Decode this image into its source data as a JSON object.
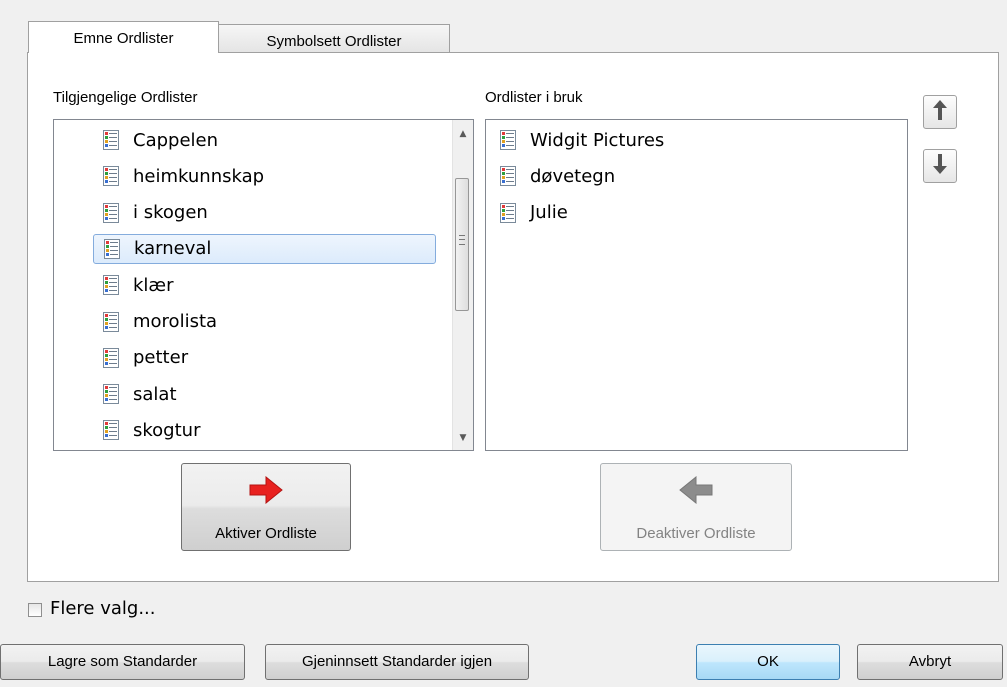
{
  "tabs": [
    {
      "label": "Emne Ordlister",
      "active": true
    },
    {
      "label": "Symbolsett Ordlister",
      "active": false
    }
  ],
  "available": {
    "label": "Tilgjengelige Ordlister",
    "items": [
      "Cappelen",
      "heimkunnskap",
      "i skogen",
      "karneval",
      "klær",
      "morolista",
      "petter",
      "salat",
      "skogtur"
    ],
    "selected_index": 3
  },
  "in_use": {
    "label": "Ordlister i bruk",
    "items": [
      "Widgit Pictures",
      "døvetegn",
      "Julie"
    ]
  },
  "buttons": {
    "activate": "Aktiver Ordliste",
    "deactivate": "Deaktiver Ordliste",
    "save_default": "Lagre som Standarder",
    "restore_default": "Gjeninnsett Standarder igjen",
    "ok": "OK",
    "cancel": "Avbryt"
  },
  "more_options": {
    "label": "Flere valg...",
    "checked": false
  },
  "icons": {
    "list": "list-icon",
    "move_up": "arrow-up-icon",
    "move_down": "arrow-down-icon",
    "activate": "red-arrow-right-icon",
    "deactivate": "gray-arrow-left-icon"
  },
  "colors": {
    "activate_arrow": "#e8211f",
    "deactivate_arrow": "#8c8c8c",
    "selection_border": "#84acdd"
  }
}
